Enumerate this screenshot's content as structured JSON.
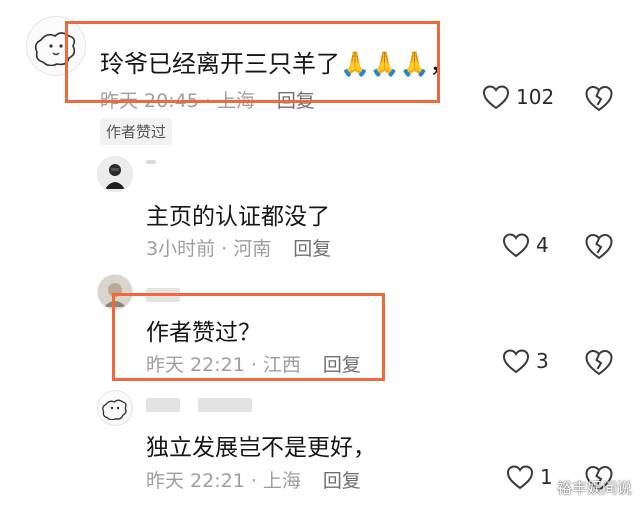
{
  "comments": [
    {
      "text": "玲爷已经离开三只羊了",
      "emoji": "🙏🙏🙏",
      "trail": "，",
      "time": "昨天 20:45 · 上海",
      "reply_label": "回复",
      "likes": "102",
      "tag": "作者赞过"
    },
    {
      "text": "主页的认证都没了",
      "time": "3小时前 · 河南",
      "reply_label": "回复",
      "likes": "4"
    },
    {
      "text": "作者赞过？",
      "time": "昨天 22:21 · 江西",
      "reply_label": "回复",
      "likes": "3"
    },
    {
      "text": "独立发展岂不是更好，",
      "time": "昨天 22:21 · 上海",
      "reply_label": "回复",
      "likes": "1"
    }
  ],
  "watermark": "裕丰娱间说",
  "colors": {
    "highlight": "#ee6a3a",
    "meta": "#9e9e9e",
    "text": "#161616",
    "icon": "#3a3a3a"
  },
  "icons": {
    "like": "heart-outline-icon",
    "dislike": "broken-heart-icon"
  }
}
